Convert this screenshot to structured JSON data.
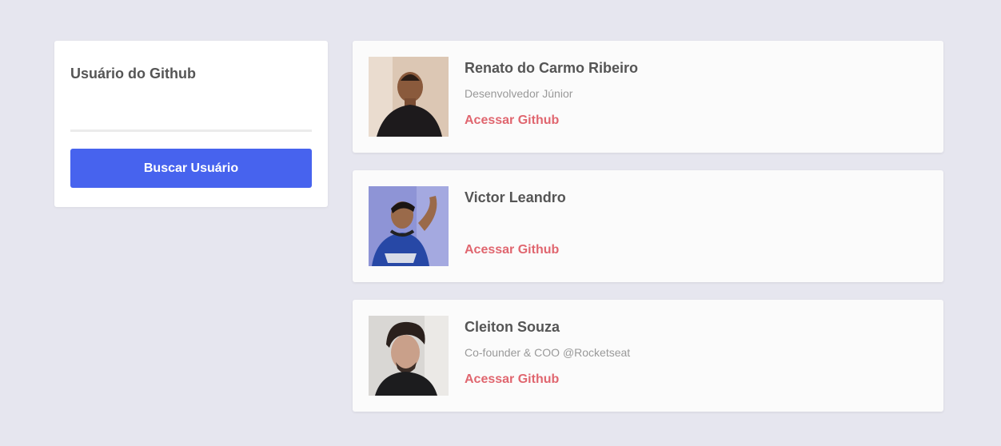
{
  "search": {
    "title": "Usuário do Github",
    "input_value": "",
    "input_placeholder": "",
    "button_label": "Buscar Usuário",
    "button_color": "#4763ee"
  },
  "users": [
    {
      "name": "Renato do Carmo Ribeiro",
      "bio": "Desenvolvedor Júnior",
      "link_label": "Acessar Github",
      "avatar_icon": "person-photo"
    },
    {
      "name": "Victor Leandro",
      "bio": "",
      "link_label": "Acessar Github",
      "avatar_icon": "person-photo"
    },
    {
      "name": "Cleiton Souza",
      "bio": "Co-founder & COO @Rocketseat",
      "link_label": "Acessar Github",
      "avatar_icon": "person-photo"
    }
  ],
  "colors": {
    "background": "#e6e6ef",
    "link": "#e0666f",
    "text": "#555555",
    "muted": "#999999"
  }
}
